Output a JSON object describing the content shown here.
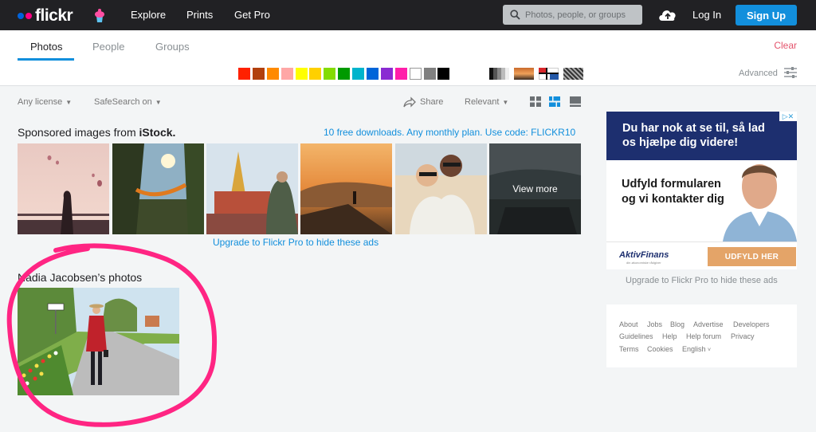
{
  "header": {
    "logo_text": "flickr",
    "nav": [
      "Explore",
      "Prints",
      "Get Pro"
    ],
    "search_placeholder": "Photos, people, or groups",
    "login": "Log In",
    "signup": "Sign Up"
  },
  "tabs": {
    "items": [
      "Photos",
      "People",
      "Groups"
    ],
    "active": "Photos",
    "clear": "Clear"
  },
  "colors": {
    "swatches": [
      "#ff2100",
      "#b2400d",
      "#ff8a00",
      "#ffa7a6",
      "#ffff00",
      "#ffd000",
      "#83dc00",
      "#009a00",
      "#00b4cc",
      "#0065d9",
      "#8a2bd2",
      "#ff1eaa",
      "#ffffff",
      "#808080",
      "#000000"
    ],
    "accent": "#128fdc",
    "annotation": "#ff2583"
  },
  "filters": {
    "license": "Any license",
    "safesearch": "SafeSearch on",
    "share": "Share",
    "sort": "Relevant",
    "advanced": "Advanced"
  },
  "sponsored": {
    "title_prefix": "Sponsored images from",
    "title_brand": "iStock.",
    "promo": "10 free downloads. Any monthly plan. Use code: FLICKR10",
    "view_more": "View more",
    "upgrade": "Upgrade to Flickr Pro to hide these ads"
  },
  "user_section": {
    "title": "Nadia Jacobsen’s photos"
  },
  "ad": {
    "headline": "Du har nok at se til, så lad os hjælpe dig videre!",
    "body": "Udfyld formularen og vi kontakter dig",
    "brand": "AktivFinans",
    "brand_sub": "din økonomiske rådgiver",
    "cta": "UDFYLD HER",
    "upgrade": "Upgrade to Flickr Pro to hide these ads"
  },
  "footer": {
    "row1": [
      "About",
      "Jobs",
      "Blog",
      "Advertise",
      "Developers"
    ],
    "row2": [
      "Guidelines",
      "Help",
      "Help forum",
      "Privacy"
    ],
    "row3": [
      "Terms",
      "Cookies",
      "English"
    ]
  }
}
